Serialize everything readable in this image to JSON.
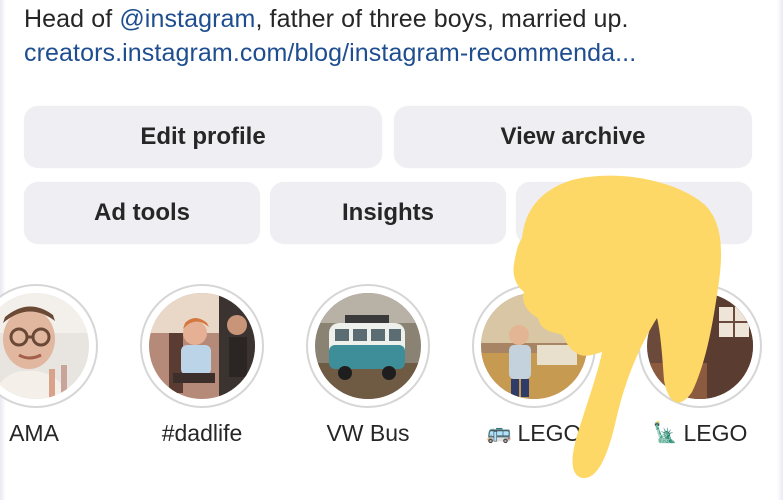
{
  "bio": {
    "prefix": "Head of ",
    "mention": "@instagram",
    "suffix": ", father of three boys, married up.",
    "link": "creators.instagram.com/blog/instagram-recommenda..."
  },
  "buttons": {
    "edit_profile": "Edit profile",
    "view_archive": "View archive",
    "ad_tools": "Ad tools",
    "insights": "Insights"
  },
  "highlights": [
    {
      "label": "AMA",
      "emoji": ""
    },
    {
      "label": "#dadlife",
      "emoji": ""
    },
    {
      "label": "VW Bus",
      "emoji": ""
    },
    {
      "label": "LEGO",
      "emoji": "🚌"
    },
    {
      "label": "LEGO",
      "emoji": "🗽"
    }
  ],
  "colors": {
    "link": "#1e4e8f",
    "button_bg": "#efeff3",
    "overlay_finger": "#fdd867"
  }
}
